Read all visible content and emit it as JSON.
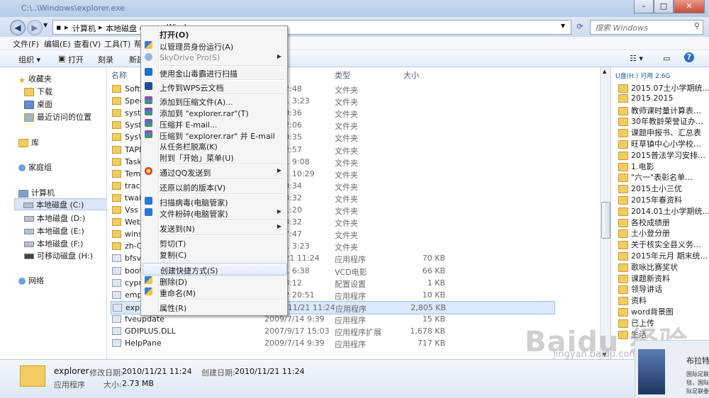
{
  "window": {
    "title": "C:\\..\\Windows\\explorer.exe",
    "controls": [
      "–",
      "□",
      "✕"
    ]
  },
  "address": {
    "breadcrumb": [
      "计算机",
      "本地磁盘 (C:)",
      "Windows"
    ],
    "search_placeholder": "搜索 Windows"
  },
  "menubar": [
    "文件(F)",
    "编辑(E)",
    "查看(V)",
    "工具(T)",
    "帮"
  ],
  "toolbar": [
    "组织 ▾",
    "打开",
    "刻录",
    "新建"
  ],
  "nav": {
    "favorites": "收藏夹",
    "downloads": "下载",
    "desktop": "桌面",
    "recent": "最近访问的位置",
    "libraries": "库",
    "homegroup": "家庭组",
    "computer": "计算机",
    "drive_c": "本地磁盘 (C:)",
    "drive_d": "本地磁盘 (D:)",
    "drive_e": "本地磁盘 (E:)",
    "drive_f": "本地磁盘 (F:)",
    "drive_h": "可移动磁盘 (H:)",
    "network": "网络"
  },
  "columns": {
    "name": "名称",
    "type": "类型",
    "size": "大小"
  },
  "files": [
    {
      "name": "Softw",
      "date": "/15 22:48",
      "type": "文件夹",
      "size": ""
    },
    {
      "name": "Spee",
      "date": "/11/21 3:23",
      "type": "文件夹",
      "size": ""
    },
    {
      "name": "syste",
      "date": "/14 10:36",
      "type": "文件夹",
      "size": ""
    },
    {
      "name": "Syste",
      "date": "/20 22:06",
      "type": "文件夹",
      "size": ""
    },
    {
      "name": "SysW",
      "date": "/14 10:35",
      "type": "文件夹",
      "size": ""
    },
    {
      "name": "TAPI",
      "date": "/14 12:57",
      "type": "文件夹",
      "size": ""
    },
    {
      "name": "Task",
      "date": "/11/21 9:08",
      "type": "文件夹",
      "size": ""
    },
    {
      "name": "Tem",
      "date": "/11/21 10:29",
      "type": "文件夹",
      "size": ""
    },
    {
      "name": "traci",
      "date": "/14 10:34",
      "type": "文件夹",
      "size": ""
    },
    {
      "name": "twai",
      "date": "/14 13:32",
      "type": "文件夹",
      "size": ""
    },
    {
      "name": "Vss",
      "date": "/14 11:20",
      "type": "文件夹",
      "size": ""
    },
    {
      "name": "Web",
      "date": "/14 13:32",
      "type": "文件夹",
      "size": ""
    },
    {
      "name": "wins",
      "date": "/19 17:47",
      "type": "文件夹",
      "size": ""
    },
    {
      "name": "zh-C",
      "date": "/11/21 3:23",
      "type": "文件夹",
      "size": ""
    },
    {
      "name": "bfsv",
      "date": "0/11/21 11:24",
      "type": "应用程序",
      "size": "70 KB"
    },
    {
      "name": "boot",
      "date": "/11/21 6:38",
      "type": "VCD电影",
      "size": "66 KB"
    },
    {
      "name": "cypr",
      "date": "/14 18:12",
      "type": "配置设置",
      "size": "1 KB"
    },
    {
      "name": "emp",
      "date": "/11/22 20:51",
      "type": "应用程序",
      "size": "10 KB"
    },
    {
      "name": "explorer",
      "date": "2010/11/21 11:24",
      "type": "应用程序",
      "size": "2,805 KB"
    },
    {
      "name": "fveupdate",
      "date": "2009/7/14 9:39",
      "type": "应用程序",
      "size": "15 KB"
    },
    {
      "name": "GDIPLUS.DLL",
      "date": "2007/9/17 15:03",
      "type": "应用程序扩展",
      "size": "1,678 KB"
    },
    {
      "name": "HelpPane",
      "date": "2009/7/14 9:39",
      "type": "应用程序",
      "size": "717 KB"
    }
  ],
  "context_menu": {
    "open": "打开(O)",
    "run_as_admin": "以管理员身份运行(A)",
    "skydrive": "SkyDrive Pro(S)",
    "jinshan": "使用金山毒霸进行扫描",
    "wps": "上传到WPS云文档",
    "add_archive": "添加到压缩文件(A)...",
    "add_rar": "添加到 \"explorer.rar\"(T)",
    "compress_email": "压缩并 E-mail...",
    "compress_rar_email": "压缩到 \"explorer.rar\" 并 E-mail",
    "unpin_taskbar": "从任务栏脱离(K)",
    "pin_start": "附到「开始」菜单(U)",
    "qq_send": "通过QQ发送到",
    "restore": "还原以前的版本(V)",
    "scan_virus": "扫描病毒(电脑管家)",
    "shred": "文件粉碎(电脑管家)",
    "send_to": "发送到(N)",
    "cut": "剪切(T)",
    "copy": "复制(C)",
    "create_shortcut": "创建快捷方式(S)",
    "delete": "删除(D)",
    "rename": "重命名(M)",
    "properties": "属性(R)"
  },
  "right_panel": {
    "header": "U盘(H:)   可用 2.6G",
    "items": [
      "2015.07土小学期统…",
      "2015.2015",
      "教师课时量计算表…",
      "30年教龄荣誉证办…",
      "课题申报书、汇总表",
      "旺草镇中心小学校…",
      "2015普法学习安排…",
      "1.电影",
      "\"六一\"表彰名单…",
      "2015土小三优",
      "2015年春资料",
      "2014.01土小学期统…",
      "各校成绩册",
      "土小登分册",
      "关于核实全县义务…",
      "2015年元月 期末统…",
      "歌咏比赛奖状",
      "课题新资料",
      "领导讲话",
      "资料",
      "word背景图",
      "已上传",
      "生活"
    ]
  },
  "details": {
    "name": "explorer",
    "modified_label": "修改日期:",
    "modified": "2010/11/21 11:24",
    "created_label": "创建日期:",
    "created": "2010/11/21 11:24",
    "type": "应用程序",
    "size_label": "大小:",
    "size": "2.73 MB"
  },
  "watermark": {
    "logo": "Baidu 经验",
    "url": "jingyan.baidu.com"
  },
  "ad": {
    "title": "布拉特",
    "lines": [
      "国际足联",
      "毯，国际",
      "际足联委"
    ]
  }
}
